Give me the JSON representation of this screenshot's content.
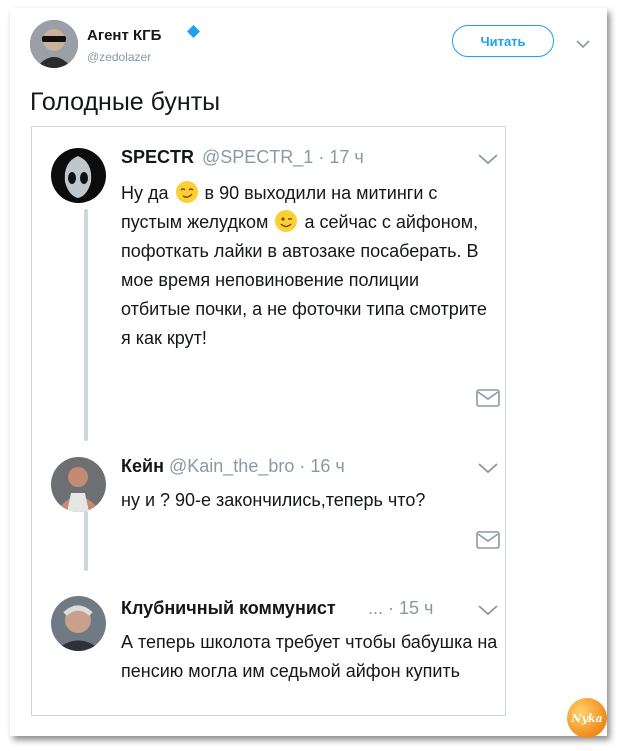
{
  "author": {
    "name": "Агент КГБ",
    "handle": "@zedolazer",
    "follow_label": "Читать"
  },
  "tweet_text": "Голодные бунты",
  "replies": [
    {
      "name": "SPECTR",
      "handle": "@SPECTR_1",
      "time": "17 ч",
      "text_parts": [
        "Ну да ",
        " в 90 выходили на митинги с пустым желудком ",
        " а сейчас с айфоном, пофоткать лайки в автозаке посаберать. В мое время неповиновение полиции отбитые почки,  а не фоточки типа смотрите я как крут!"
      ]
    },
    {
      "name": "Кейн",
      "handle": "@Kain_the_bro",
      "time": "16 ч",
      "text": "ну и ? 90-е закончились,теперь что?"
    },
    {
      "name": "Клубничный коммунист",
      "handle": "...",
      "time": "15 ч",
      "text": "А теперь школота требует чтобы бабушка на пенсию могла им седьмой айфон купить"
    }
  ],
  "watermark": "Nyka",
  "colors": {
    "accent": "#1da1f2",
    "muted": "#8899a6",
    "border": "#ccd6dd"
  }
}
